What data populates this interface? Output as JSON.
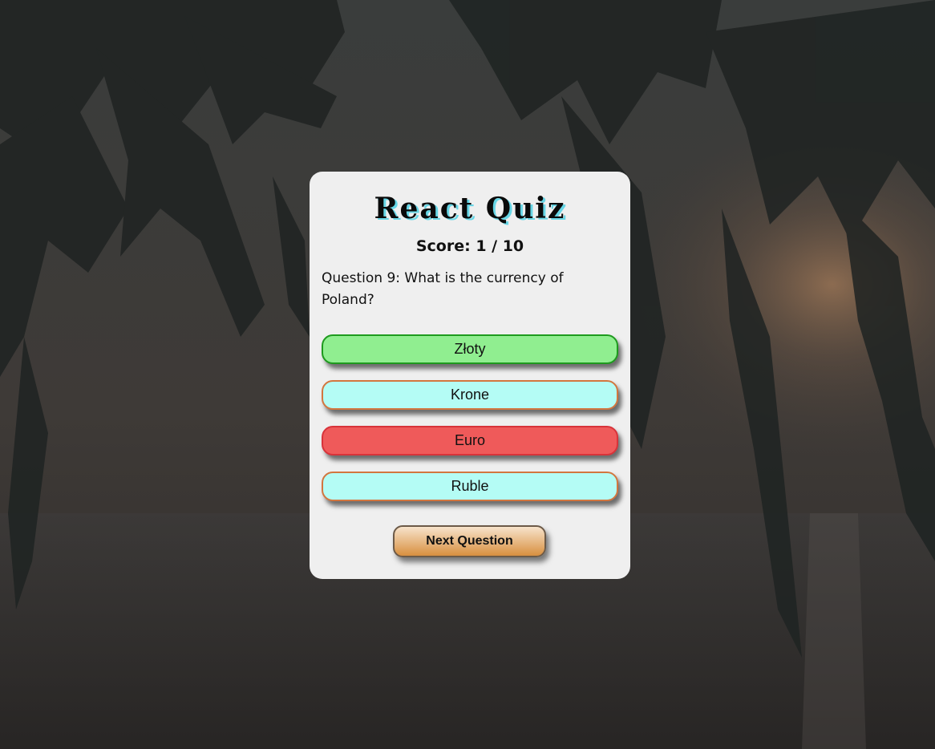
{
  "app": {
    "title": "React Quiz"
  },
  "score": {
    "label": "Score: 1 / 10",
    "current": 1,
    "total": 10
  },
  "question": {
    "number": 9,
    "text": "Question 9: What is the currency of Poland?"
  },
  "answers": [
    {
      "label": "Złoty",
      "state": "correct"
    },
    {
      "label": "Krone",
      "state": "neutral"
    },
    {
      "label": "Euro",
      "state": "wrong"
    },
    {
      "label": "Ruble",
      "state": "neutral"
    }
  ],
  "next_button": {
    "label": "Next Question"
  },
  "colors": {
    "correct": "#90ee90",
    "wrong": "#ef5a5a",
    "neutral": "#b4fcf5",
    "card": "#efefef",
    "title_shadow": "#67d6e6"
  },
  "background": {
    "description_icon": "palm-beach-sunset-image"
  }
}
